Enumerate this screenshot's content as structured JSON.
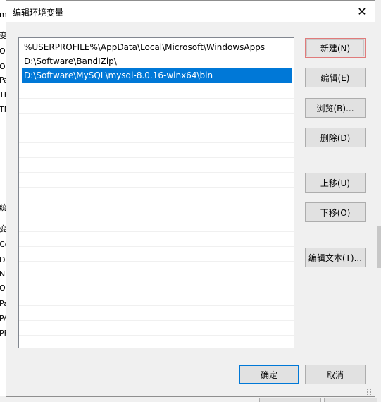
{
  "window": {
    "title": "编辑环境变量",
    "close_glyph": "✕"
  },
  "paths": [
    {
      "value": "%USERPROFILE%\\AppData\\Local\\Microsoft\\WindowsApps",
      "selected": false
    },
    {
      "value": "D:\\Software\\BandIZip\\",
      "selected": false
    },
    {
      "value": "D:\\Software\\MySQL\\mysql-8.0.16-winx64\\bin",
      "selected": true
    }
  ],
  "buttons": {
    "new": "新建(N)",
    "edit": "编辑(E)",
    "browse": "浏览(B)...",
    "delete": "删除(D)",
    "move_up": "上移(U)",
    "move_down": "下移(O)",
    "edit_text": "编辑文本(T)...",
    "ok": "确定",
    "cancel": "取消"
  },
  "background_window": {
    "fragments_top": [
      "变",
      "O",
      "O",
      "Pa",
      "TE",
      "TN"
    ],
    "fragments_bottom": [
      "统",
      "变",
      "Co",
      "Dr",
      "N",
      "O",
      "Pa",
      "PA",
      "PF"
    ]
  },
  "colors": {
    "selection": "#0078d7",
    "dialog_bg": "#f0f0f0",
    "default_button_border": "#0078d7"
  }
}
